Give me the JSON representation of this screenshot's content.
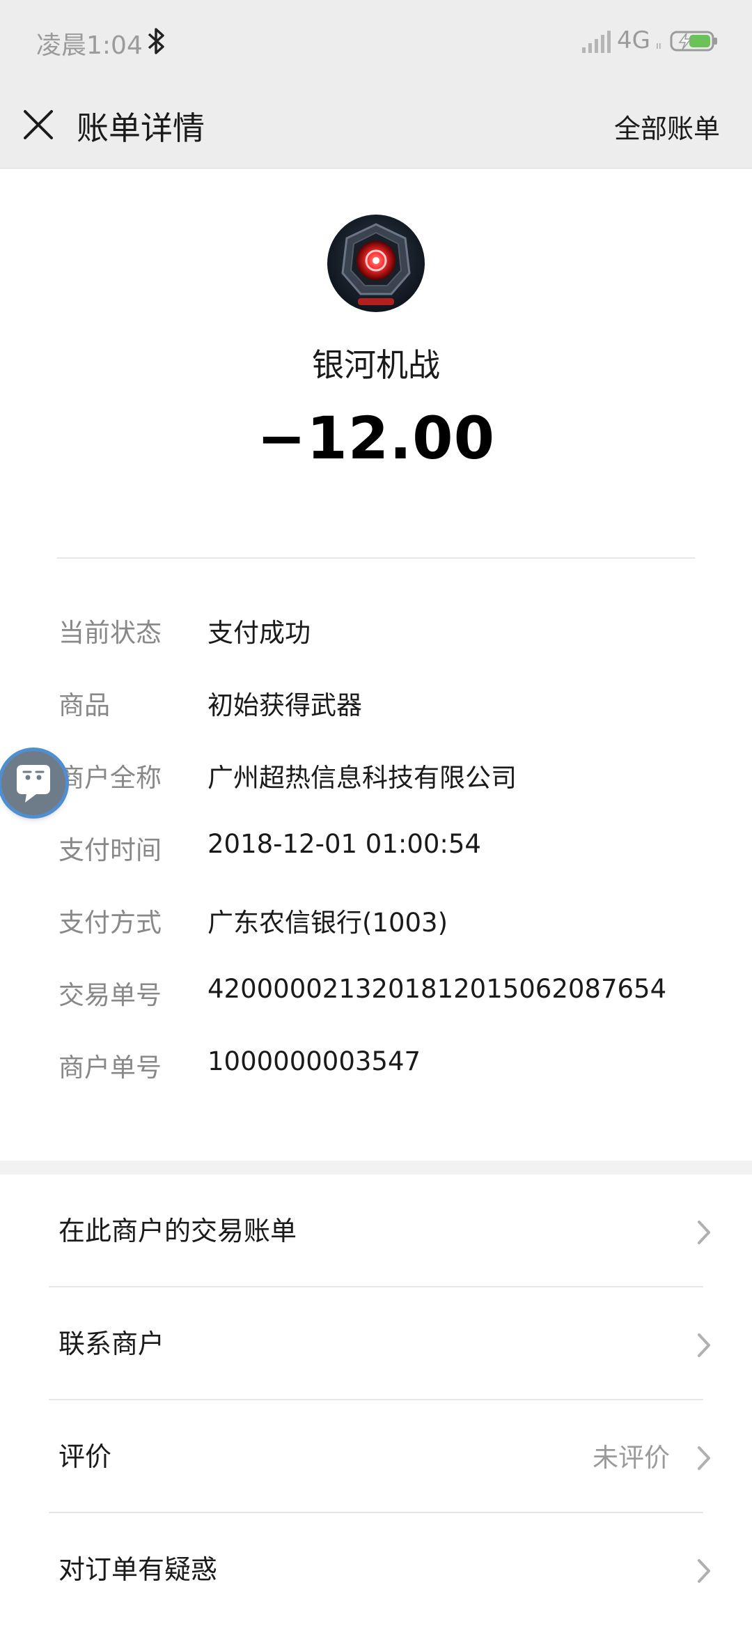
{
  "status_bar": {
    "time": "凌晨1:04",
    "network": "4G",
    "network_sub": "ıı"
  },
  "nav": {
    "title": "账单详情",
    "right_link": "全部账单"
  },
  "header": {
    "merchant_name": "银河机战",
    "amount": "−12.00"
  },
  "details": [
    {
      "label": "当前状态",
      "value": "支付成功"
    },
    {
      "label": "商品",
      "value": "初始获得武器"
    },
    {
      "label": "商户全称",
      "value": "广州超热信息科技有限公司"
    },
    {
      "label": "支付时间",
      "value": "2018-12-01 01:00:54"
    },
    {
      "label": "支付方式",
      "value": "广东农信银行(1003)"
    },
    {
      "label": "交易单号",
      "value": "4200000213201812015062087654"
    },
    {
      "label": "商户单号",
      "value": "1000000003547"
    }
  ],
  "menu": [
    {
      "label": "在此商户的交易账单",
      "extra": ""
    },
    {
      "label": "联系商户",
      "extra": ""
    },
    {
      "label": "评价",
      "extra": "未评价"
    },
    {
      "label": "对订单有疑惑",
      "extra": ""
    }
  ],
  "colors": {
    "bar_background": "#ededed",
    "label_gray": "#888888",
    "battery_green": "#6ac259"
  }
}
